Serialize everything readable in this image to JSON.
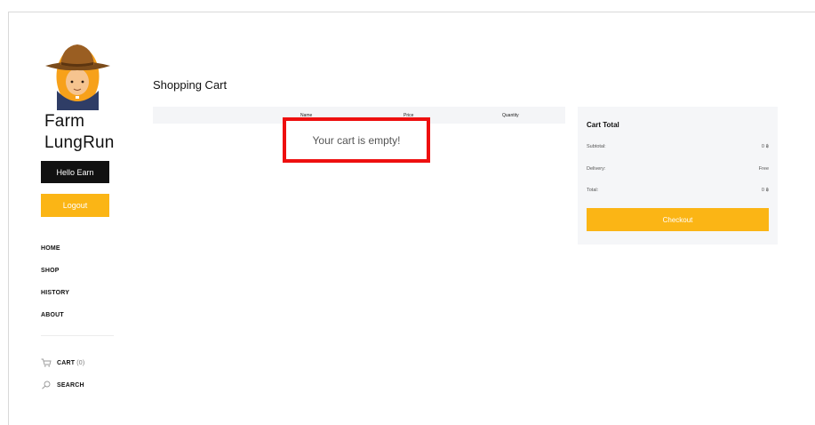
{
  "sidebar": {
    "brand": "Farm LungRun",
    "hello_label": "Hello Earn",
    "logout_label": "Logout",
    "nav": [
      {
        "label": "HOME"
      },
      {
        "label": "SHOP"
      },
      {
        "label": "HISTORY"
      },
      {
        "label": "ABOUT"
      }
    ],
    "cart_label": "CART",
    "cart_count": "(0)",
    "search_label": "SEARCH"
  },
  "main": {
    "title": "Shopping Cart",
    "columns": [
      "Name",
      "Price",
      "Quantity"
    ],
    "empty_message": "Your cart is empty!"
  },
  "cart_total": {
    "title": "Cart Total",
    "rows": [
      {
        "label": "Subtotal:",
        "value": "0 ฿"
      },
      {
        "label": "Delivery:",
        "value": "Free"
      },
      {
        "label": "Total:",
        "value": "0 ฿"
      }
    ],
    "checkout_label": "Checkout"
  },
  "colors": {
    "accent": "#fbb515",
    "dark": "#111111",
    "highlight": "#ee0f0f",
    "panel": "#f5f6f8"
  },
  "icons": {
    "avatar": "farmer-avatar",
    "cart": "cart-icon",
    "search": "search-icon"
  }
}
